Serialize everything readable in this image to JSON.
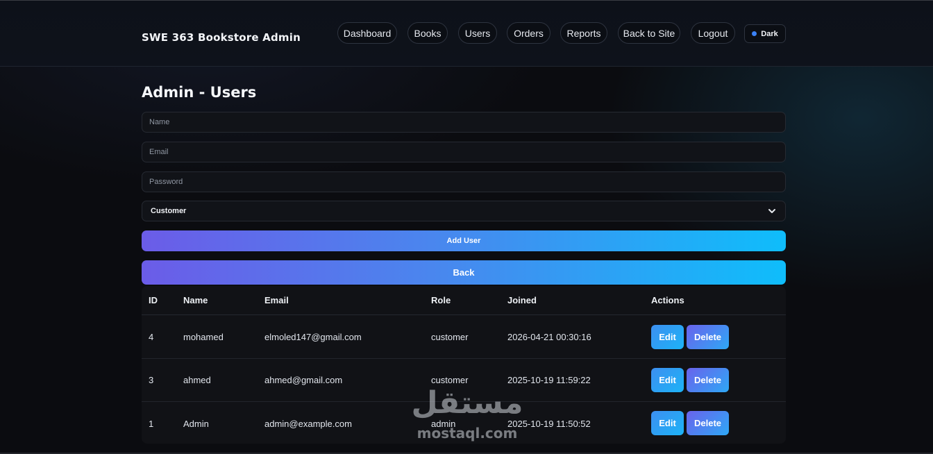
{
  "header": {
    "brand": "SWE 363 Bookstore Admin",
    "nav": [
      {
        "label": "Dashboard"
      },
      {
        "label": "Books"
      },
      {
        "label": "Users"
      },
      {
        "label": "Orders"
      },
      {
        "label": "Reports"
      },
      {
        "label": "Back to Site"
      },
      {
        "label": "Logout"
      }
    ],
    "theme_toggle": {
      "label": "Dark",
      "dot_color": "#3b82f6"
    }
  },
  "page": {
    "title": "Admin - Users"
  },
  "form": {
    "name_placeholder": "Name",
    "email_placeholder": "Email",
    "password_placeholder": "Password",
    "role_selected": "Customer",
    "add_label": "Add User",
    "back_label": "Back"
  },
  "table": {
    "headers": {
      "id": "ID",
      "name": "Name",
      "email": "Email",
      "role": "Role",
      "joined": "Joined",
      "actions": "Actions"
    },
    "rows": [
      {
        "id": "4",
        "name": "mohamed",
        "email": "elmoled147@gmail.com",
        "role": "customer",
        "joined": "2026-04-21 00:30:16",
        "edit": "Edit",
        "delete": "Delete"
      },
      {
        "id": "3",
        "name": "ahmed",
        "email": "ahmed@gmail.com",
        "role": "customer",
        "joined": "2025-10-19 11:59:22",
        "edit": "Edit",
        "delete": "Delete"
      },
      {
        "id": "1",
        "name": "Admin",
        "email": "admin@example.com",
        "role": "admin",
        "joined": "2025-10-19 11:50:52",
        "edit": "Edit",
        "delete": "Delete"
      }
    ]
  },
  "watermark": {
    "arabic": "مستقل",
    "latin": "mostaql.com"
  },
  "colors": {
    "accent_start": "#6b5ce8",
    "accent_end": "#0fbdfb",
    "background": "#0b0c10"
  }
}
